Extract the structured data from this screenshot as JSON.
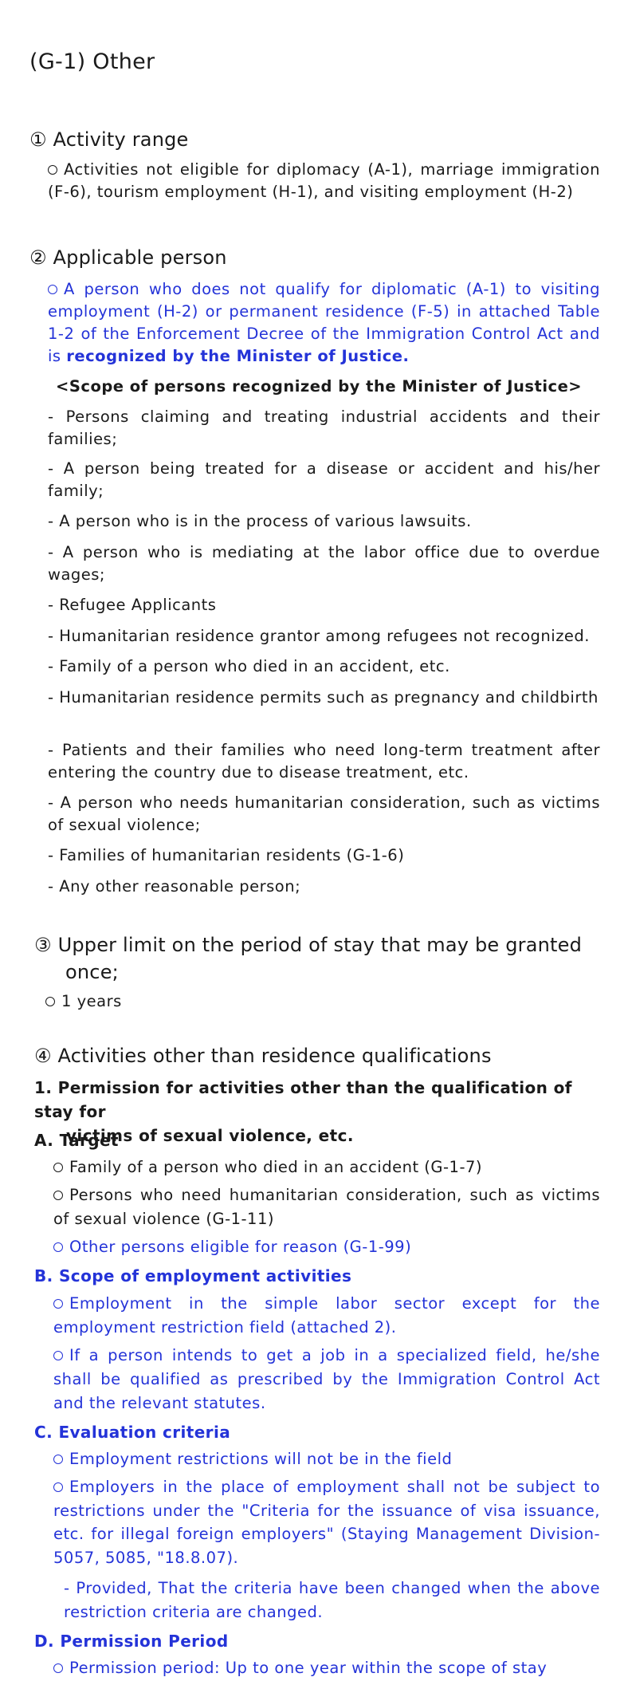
{
  "title": "(G-1) Other",
  "s1": {
    "heading": "① Activity range",
    "text": "Activities not eligible for diplomacy (A-1), marriage immigration (F-6), tourism employment (H-1), and visiting employment (H-2)"
  },
  "s2": {
    "heading": "② Applicable person",
    "text_a": "A person who does not qualify for diplomatic (A-1) to visiting employment (H-2) or permanent residence (F-5) in attached Table 1-2 of the Enforcement Decree of the Immigration Control Act and is",
    "text_b": "recognized by the Minister of Justice.",
    "scope_heading": "<Scope of persons recognized by the Minister of Justice>",
    "items": [
      "- Persons claiming and treating industrial accidents and their families;",
      "- A person being treated for a disease or accident and his/her family;",
      "- A person who is in the process of various lawsuits.",
      "- A person who is mediating at the labor office due to overdue wages;",
      "- Refugee Applicants",
      "- Humanitarian residence grantor among refugees not recognized.",
      "- Family of a person who died in an accident, etc.",
      "- Humanitarian residence permits such as pregnancy and childbirth",
      "- Patients and their families who need long-term treatment after entering the country due to disease treatment, etc.",
      "- A person who needs humanitarian consideration, such as victims of sexual violence;",
      "- Families of humanitarian residents (G-1-6)",
      "- Any other reasonable person;"
    ]
  },
  "s3": {
    "heading_num": "③",
    "heading_line1": "Upper limit on the period of stay that may be granted",
    "heading_line2": "once;",
    "text": "1 years"
  },
  "s4": {
    "heading": "④ Activities other than residence qualifications",
    "item1_line1": "1. Permission for activities other than the qualification of stay for",
    "item1_line2": "victims of sexual violence, etc.",
    "a_heading": "A. Target",
    "a_items": [
      "Family of a person who died in an accident (G-1-7)",
      "Persons who need humanitarian consideration, such as victims of sexual violence (G-1-11)",
      "Other persons eligible for reason (G-1-99)"
    ],
    "b_heading": "B. Scope of employment activities",
    "b_items": [
      "Employment in the simple labor sector except for the employment restriction field (attached 2).",
      "If a person intends to get a job in a specialized field, he/she shall be qualified as prescribed by the Immigration Control Act and the relevant statutes."
    ],
    "c_heading": "C. Evaluation criteria",
    "c_items": [
      "Employment restrictions will not be in the field",
      "Employers in the place of employment shall not be subject to restrictions under the \"Criteria for the issuance of visa issuance, etc. for illegal foreign employers\" (Staying Management Division-5057, 5085, \"18.8.07)."
    ],
    "c_note": "- Provided, That the criteria have been changed when the above restriction criteria are changed.",
    "d_heading": "D. Permission Period",
    "d_items": [
      "Permission period: Up to one year within the scope of stay"
    ]
  },
  "colors": {
    "text": "#1a1a1a",
    "accent": "#2433d8"
  }
}
